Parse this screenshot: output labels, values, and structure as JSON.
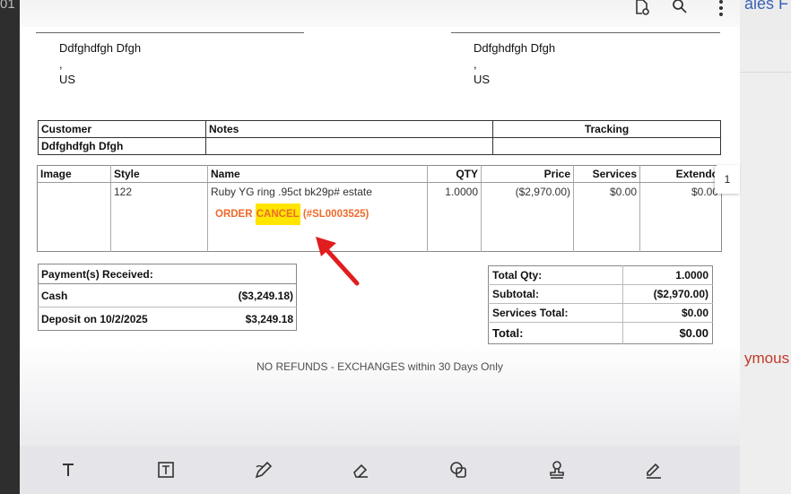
{
  "background": {
    "left_text": "01",
    "right_title": "ales F",
    "right_side_text": "ymous"
  },
  "viewer": {
    "top_icons": [
      "document-settings-icon",
      "search-icon",
      "more-vert-icon"
    ],
    "page_indicator": "1",
    "bottom_tools": [
      "text-tool-icon",
      "text-box-icon",
      "draw-icon",
      "eraser-icon",
      "shapes-icon",
      "stamp-icon",
      "signature-icon"
    ]
  },
  "document": {
    "bill_to": {
      "name": "Ddfghdfgh Dfgh",
      "line2": ",",
      "country": "US"
    },
    "ship_to": {
      "name": "Ddfghdfgh Dfgh",
      "line2": ",",
      "country": "US"
    },
    "customer_table": {
      "headers": {
        "customer": "Customer",
        "notes": "Notes",
        "tracking": "Tracking"
      },
      "values": {
        "customer": "Ddfghdfgh Dfgh",
        "notes": "",
        "tracking": ""
      }
    },
    "items_table": {
      "headers": {
        "image": "Image",
        "style": "Style",
        "name": "Name",
        "qty": "QTY",
        "price": "Price",
        "services": "Services",
        "extended": "Extendo"
      },
      "row": {
        "style": "122",
        "name": "Ruby YG ring .95ct bk29p# estate",
        "qty": "1.0000",
        "price": "($2,970.00)",
        "services": "$0.00",
        "extended": "$0.00"
      },
      "order_cancel": {
        "prefix": "ORDER ",
        "highlighted": "CANCEL",
        "suffix": " (#SL0003525)"
      }
    },
    "payments": {
      "title": "Payment(s) Received:",
      "rows": [
        {
          "label": "Cash",
          "amount": "($3,249.18)"
        },
        {
          "label": "Deposit on 10/2/2025",
          "amount": "$3,249.18"
        }
      ]
    },
    "totals": [
      {
        "label": "Total Qty:",
        "value": "1.0000"
      },
      {
        "label": "Subtotal:",
        "value": "($2,970.00)"
      },
      {
        "label": "Services Total:",
        "value": "$0.00"
      },
      {
        "label": "Total:",
        "value": "$0.00"
      }
    ],
    "footer_note": "NO REFUNDS - EXCHANGES within 30 Days Only"
  },
  "colors": {
    "highlight": "#ffe500",
    "cancel_text": "#ef6a2a",
    "arrow": "#e11d1d"
  }
}
